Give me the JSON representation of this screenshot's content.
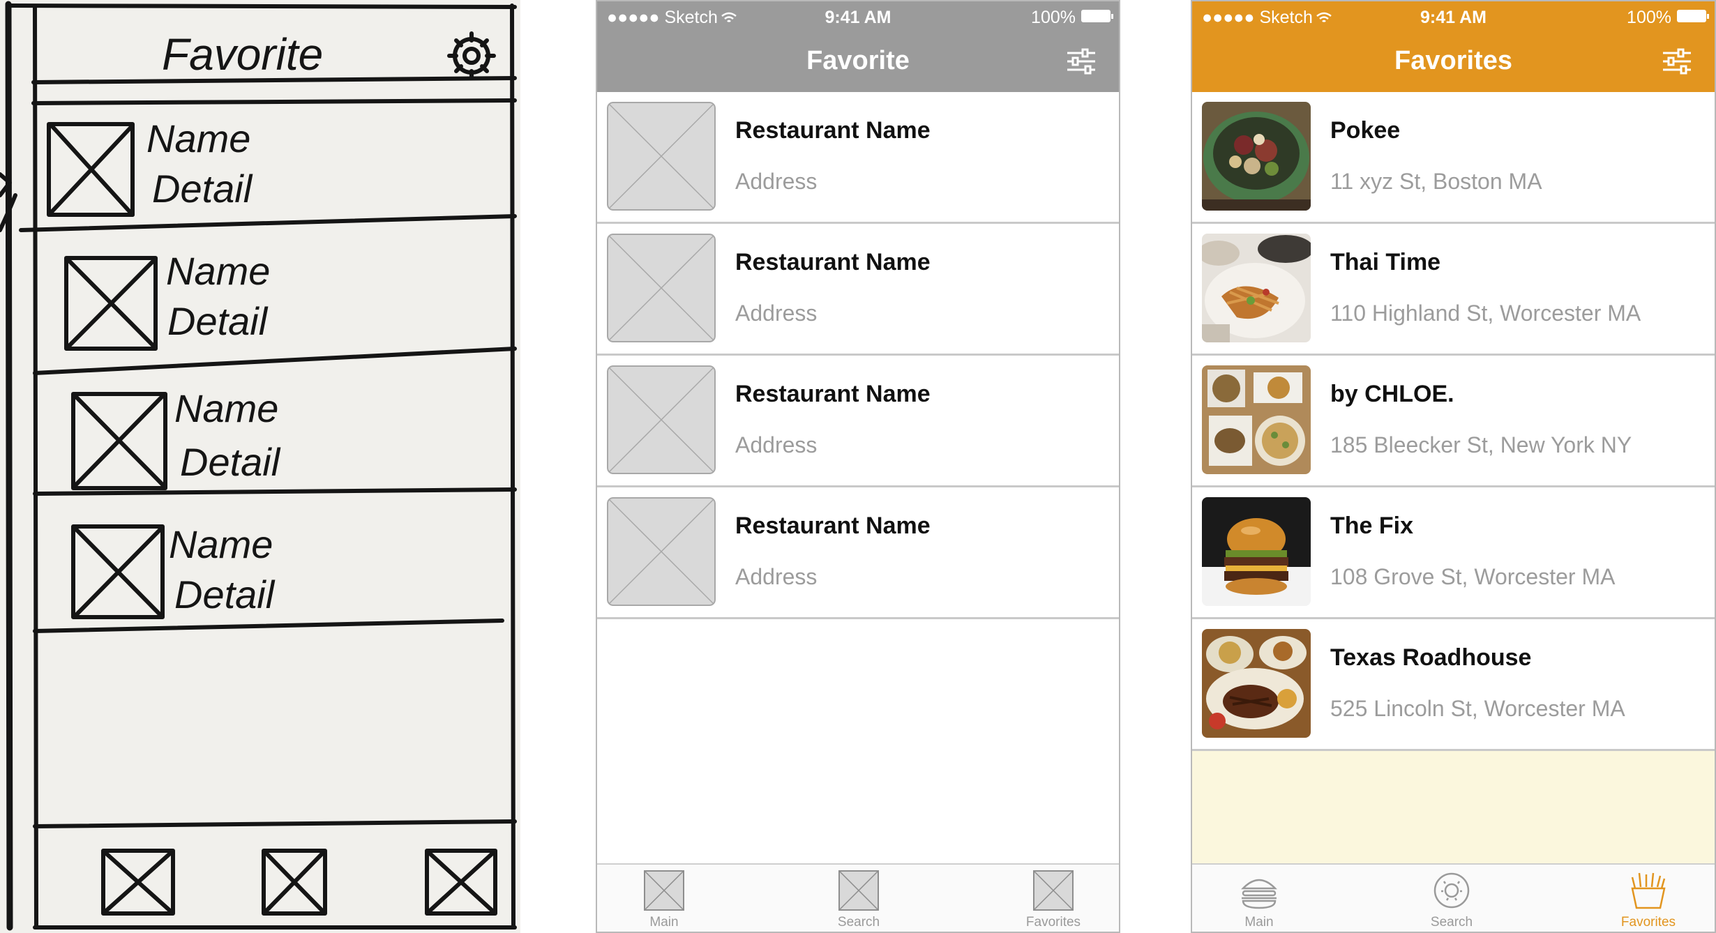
{
  "sketch": {
    "title": "Favorite",
    "rows": [
      {
        "name": "Name",
        "detail": "Detail"
      },
      {
        "name": "Name",
        "detail": "Detail"
      },
      {
        "name": "Name",
        "detail": "Detail"
      },
      {
        "name": "Name",
        "detail": "Detail"
      }
    ]
  },
  "wireframe": {
    "status": {
      "carrier": "●●●●● Sketch",
      "time": "9:41 AM",
      "battery": "100%"
    },
    "title": "Favorite",
    "filter_icon": "sliders-icon",
    "colors": {
      "navbar": "#9b9b9b",
      "placeholder": "#d9d9d9"
    },
    "rows": [
      {
        "name": "Restaurant Name",
        "address": "Address"
      },
      {
        "name": "Restaurant Name",
        "address": "Address"
      },
      {
        "name": "Restaurant Name",
        "address": "Address"
      },
      {
        "name": "Restaurant Name",
        "address": "Address"
      }
    ],
    "tabs": [
      {
        "label": "Main",
        "icon": "placeholder-icon"
      },
      {
        "label": "Search",
        "icon": "placeholder-icon"
      },
      {
        "label": "Favorites",
        "icon": "placeholder-icon"
      }
    ]
  },
  "final": {
    "status": {
      "carrier": "●●●●● Sketch",
      "time": "9:41 AM",
      "battery": "100%"
    },
    "title": "Favorites",
    "filter_icon": "sliders-icon",
    "colors": {
      "navbar": "#e2951f",
      "empty_area": "#fbf7dd",
      "active_tab": "#e2951f"
    },
    "rows": [
      {
        "name": "Pokee",
        "address": "11 xyz St, Boston MA",
        "photo": "poke-bowl-photo"
      },
      {
        "name": "Thai Time",
        "address": "110 Highland St, Worcester MA",
        "photo": "thai-noodles-photo"
      },
      {
        "name": "by CHLOE.",
        "address": "185 Bleecker St, New York NY",
        "photo": "burger-spread-photo"
      },
      {
        "name": "The Fix",
        "address": "108 Grove St, Worcester MA",
        "photo": "burger-photo"
      },
      {
        "name": "Texas Roadhouse",
        "address": "525 Lincoln St, Worcester MA",
        "photo": "steak-platter-photo"
      }
    ],
    "tabs": [
      {
        "label": "Main",
        "icon": "burger-icon",
        "active": false
      },
      {
        "label": "Search",
        "icon": "donut-icon",
        "active": false
      },
      {
        "label": "Favorites",
        "icon": "fries-icon",
        "active": true
      }
    ]
  }
}
